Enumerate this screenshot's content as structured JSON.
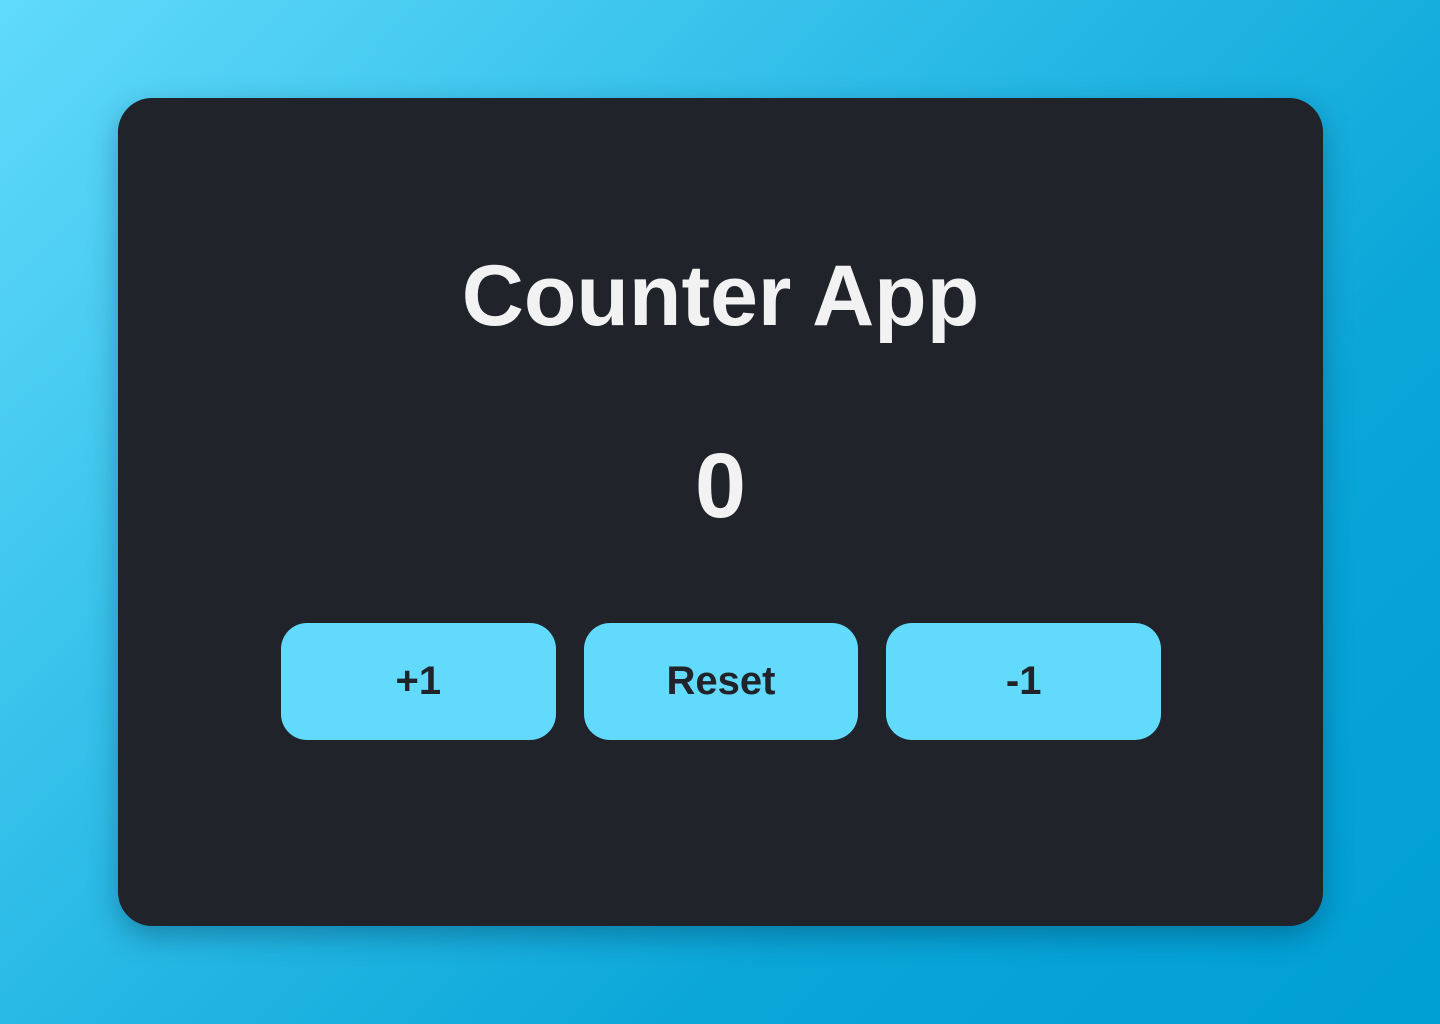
{
  "app": {
    "title": "Counter App",
    "count": "0"
  },
  "buttons": {
    "increment_label": "+1",
    "reset_label": "Reset",
    "decrement_label": "-1"
  },
  "colors": {
    "card_background": "#21232b",
    "accent": "#61dafb",
    "text_light": "#f2f2f2",
    "button_text": "#21232b"
  }
}
